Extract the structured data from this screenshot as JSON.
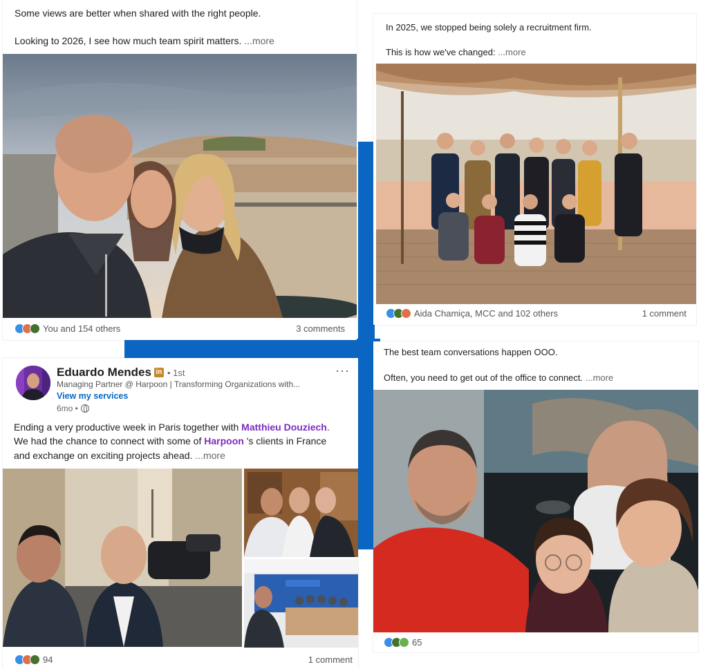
{
  "post1": {
    "line1": "Some views are better when shared with the right people.",
    "line2": "Looking to 2026, I see how much team spirit matters.",
    "more": "...more",
    "reactions_text": "You and 154 others",
    "comments": "3 comments"
  },
  "post2": {
    "line1": "In 2025, we stopped being solely a recruitment firm.",
    "line2": "This is how we've changed:",
    "more": "...more",
    "reactions_text": "Aida Chamiça, MCC and 102 others",
    "comments": "1 comment"
  },
  "post3": {
    "author": "Eduardo Mendes",
    "li_badge": "in",
    "degree": "• 1st",
    "headline": "Managing Partner @ Harpoon | Transforming Organizations with...",
    "services": "View my services",
    "age": "6mo •",
    "text1": "Ending a very productive week in Paris together with ",
    "mention1": "Matthieu Douziech",
    "text1_end": ".",
    "text2": "We had the chance to connect with some of ",
    "mention2": "Harpoon",
    "text2_end": " 's clients in France",
    "text3": "and exchange on exciting projects ahead.",
    "more": "...more",
    "reactions_count": "94",
    "comments": "1 comment"
  },
  "post4": {
    "line1": "The best team conversations happen OOO.",
    "line2": "Often, you need to get out of the office to connect.",
    "more": "...more",
    "reactions_count": "65"
  },
  "colors": {
    "connector": "#0a66c2",
    "mention": "#7b2cbf",
    "services_link": "#0a66c2"
  }
}
